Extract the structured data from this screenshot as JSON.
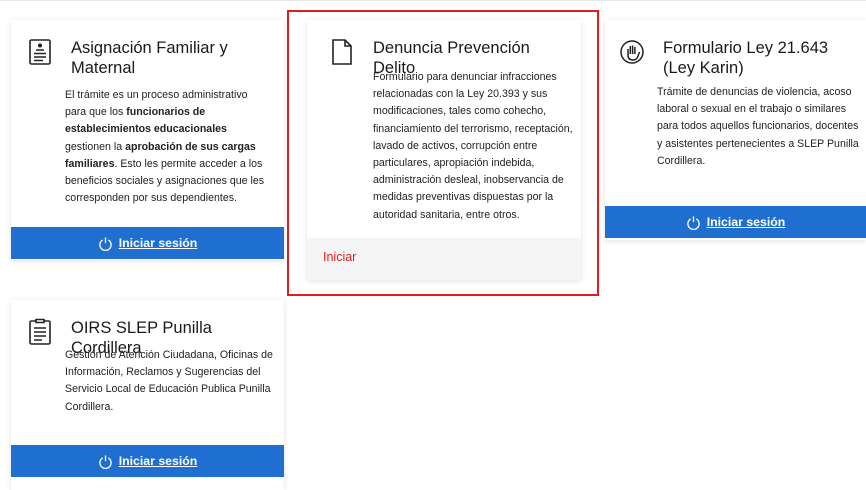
{
  "cards": {
    "asignacion": {
      "title": "Asignación Familiar y Maternal",
      "desc": [
        {
          "t": "El trámite es un proceso administrativo para que los ",
          "b": false
        },
        {
          "t": "funcionarios de establecimientos educacionales",
          "b": true
        },
        {
          "t": " gestionen la ",
          "b": false
        },
        {
          "t": "aprobación de sus cargas familiares",
          "b": true
        },
        {
          "t": ". Esto les permite acceder a los beneficios sociales y asignaciones que les corresponden por sus dependientes.",
          "b": false
        }
      ],
      "icon": "document-list-icon",
      "button_label": "Iniciar sesión"
    },
    "denuncia": {
      "title": "Denuncia Prevención Delito",
      "desc": "Formulario para denunciar infracciones relacionadas con la Ley 20.393 y sus modificaciones, tales como cohecho, financiamiento del terrorismo, receptación, lavado de activos, corrupción entre particulares, apropiación indebida, administración desleal, inobservancia de medidas preventivas dispuestas por la autoridad sanitaria, entre otros.",
      "icon": "blank-document-icon",
      "button_label": "Iniciar"
    },
    "karin": {
      "title": "Formulario Ley 21.643 (Ley Karin)",
      "desc": "Trámite de denuncias de violencia, acoso laboral o sexual en el trabajo o similares para todos aquellos funcionarios, docentes y asistentes pertenecientes a SLEP Punilla Cordillera.",
      "icon": "raised-hand-icon",
      "button_label": "Iniciar sesión"
    },
    "oirs": {
      "title": "OIRS SLEP Punilla Cordillera",
      "desc": "Gestión de Atención Ciudadana, Oficinas de Información, Reclamos y Sugerencias del Servicio Local de Educación Publica Punilla Cordillera.",
      "icon": "form-document-icon",
      "button_label": "Iniciar sesión"
    }
  },
  "colors": {
    "login_bar": "#1f6fd1",
    "iniciar_text": "#e0201a",
    "highlight_border": "#e41b1b"
  }
}
